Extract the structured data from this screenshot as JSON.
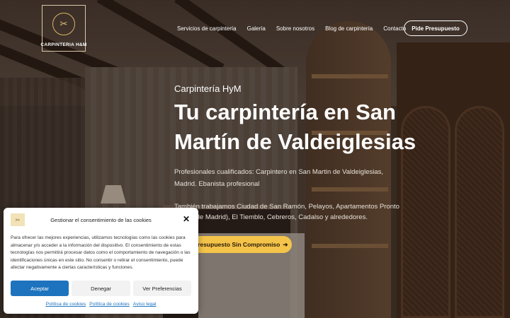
{
  "header": {
    "logo_text": "CARPINTERIA H&M",
    "nav": [
      "Servicios de carpintería",
      "Galería",
      "Sobre nosotros",
      "Blog de carpintería",
      "Contacto"
    ],
    "cta_label": "Pide Presupuesto"
  },
  "hero": {
    "eyebrow": "Carpintería HyM",
    "title": "Tu carpintería en San Martín de Valdeiglesias",
    "subtitle": "Profesionales cualificados: Carpintero en San Martin de Valdeiglesias, Madrid. Ebanista profesional",
    "areas": "También trabajamos Ciudad de San Ramón, Pelayos, Apartamentos Pronto (Costa de Madrid), El Tiemblo, Cebreros, Cadalso y alrededores.",
    "cta_label": "Presupuesto Sin Compromiso",
    "cta_arrow": "➔",
    "accent_color": "#f4c44a"
  },
  "cookie": {
    "title": "Gestionar el consentimiento de las cookies",
    "close_glyph": "✕",
    "body": "Para ofrecer las mejores experiencias, utilizamos tecnologías como las cookies para almacenar y/o acceder a la información del dispositivo. El consentimiento de estas tecnologías nos permitirá procesar datos como el comportamiento de navegación o las identificaciones únicas en este sitio. No consentir o retirar el consentimiento, puede afectar negativamente a ciertas características y funciones.",
    "accept_label": "Aceptar",
    "deny_label": "Denegar",
    "prefs_label": "Ver Preferencias",
    "links": [
      "Política de cookies",
      "Política de cookies",
      "Aviso legal"
    ],
    "accent_color": "#1e73be"
  }
}
